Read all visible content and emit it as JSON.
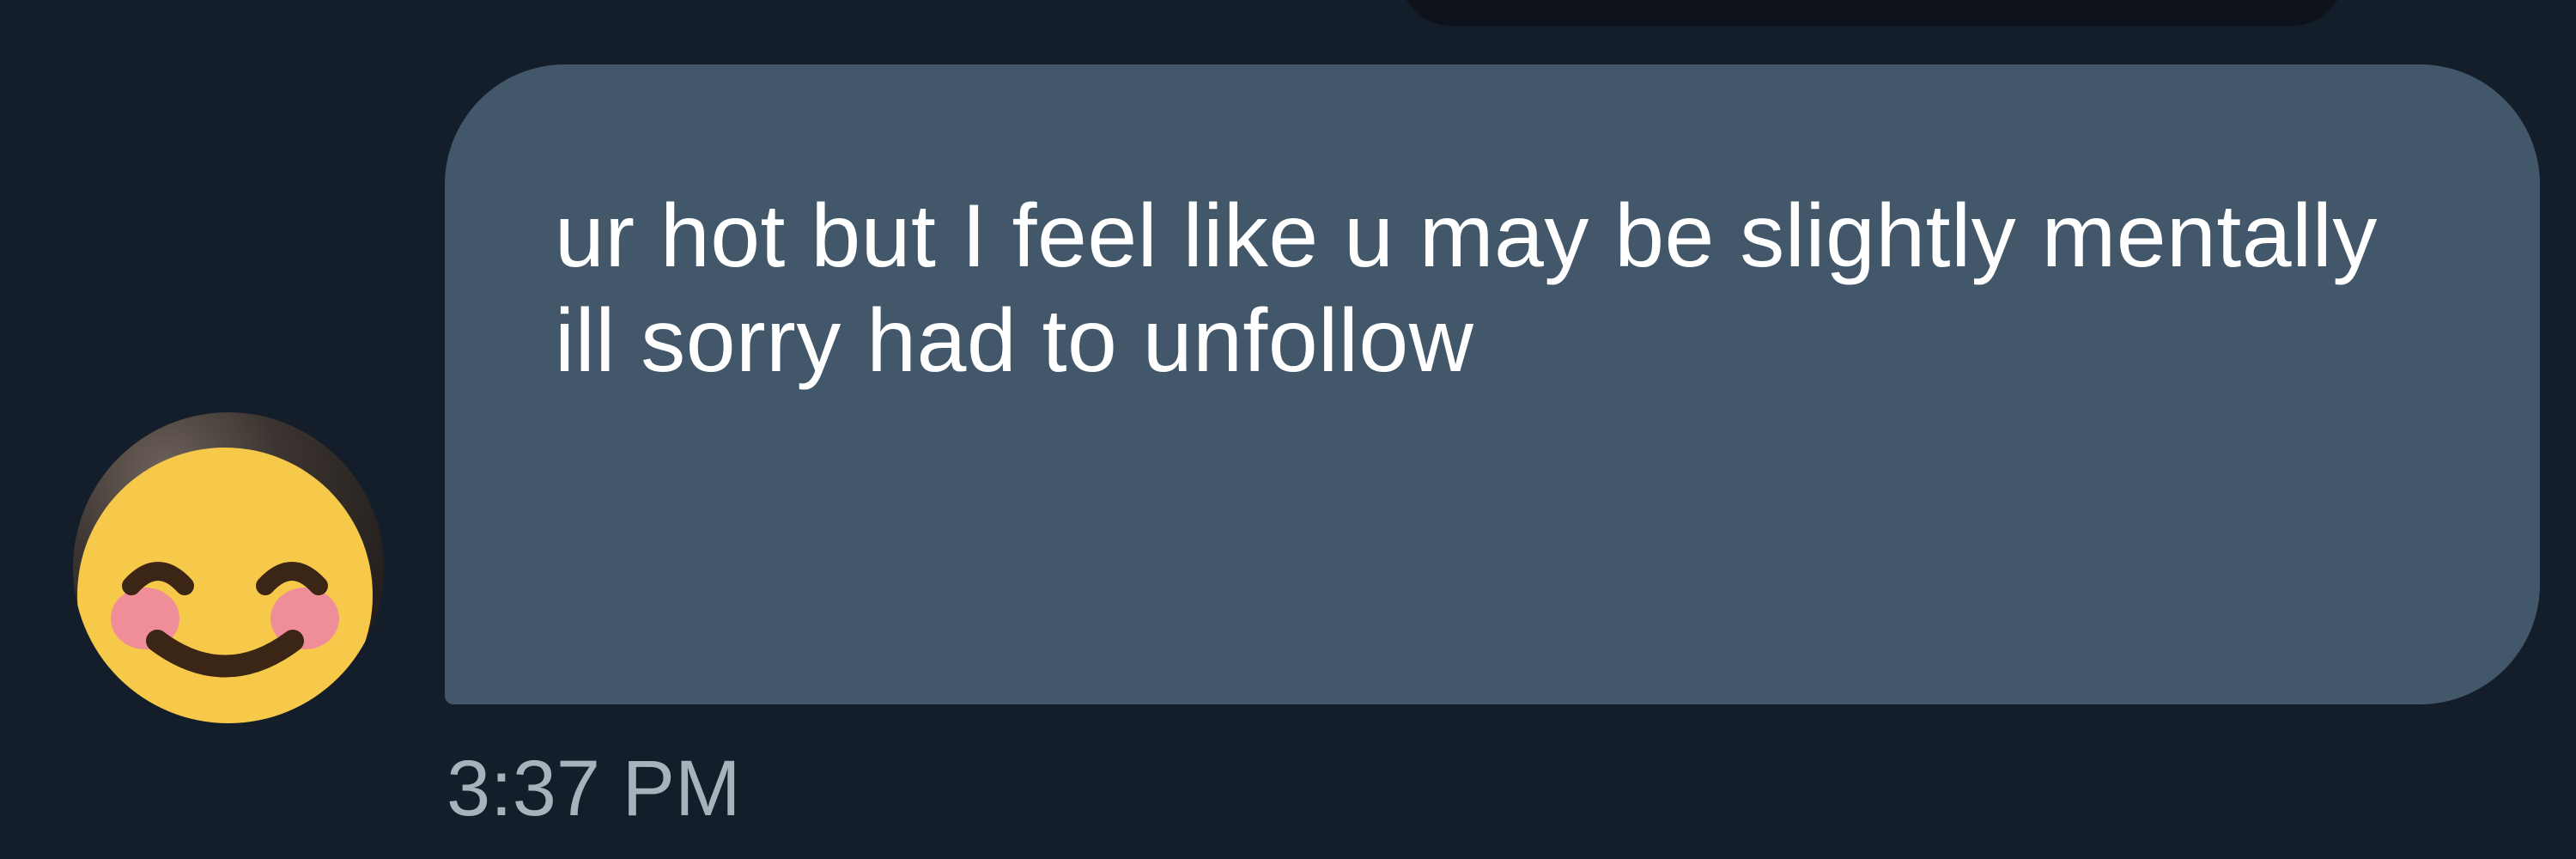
{
  "conversation": {
    "message": {
      "text": "ur hot but I feel like u may be slightly mentally ill sorry had to unfollow",
      "timestamp": "3:37 PM"
    },
    "avatar": {
      "icon": "smiling-face-with-smiling-eyes-icon"
    }
  },
  "colors": {
    "background": "#141d2a",
    "bubble": "#425769",
    "message_text": "#ffffff",
    "timestamp_text": "#a8b2bd",
    "emoji_face": "#f6c94a",
    "emoji_blush": "#ef8d98",
    "emoji_features": "#3b2515"
  }
}
